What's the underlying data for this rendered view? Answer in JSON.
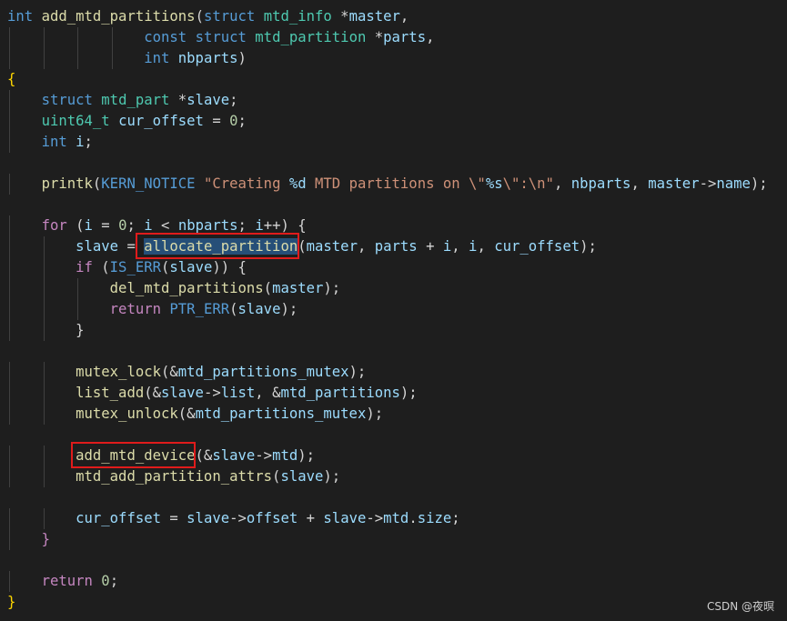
{
  "editor": {
    "language": "c",
    "theme_colors": {
      "background": "#1e1e1e",
      "keyword": "#569cd6",
      "type": "#4ec9b0",
      "function": "#dcdcaa",
      "variable": "#9cdcfe",
      "number": "#b5cea8",
      "string": "#ce9178",
      "macro": "#569cd6",
      "control": "#c586c0",
      "brace": "#ffd700",
      "default": "#d4d4d4",
      "highlight_border": "#e01b1b",
      "selection": "#264f78"
    },
    "lines": [
      [
        [
          "int",
          "keyword"
        ],
        [
          " ",
          "default"
        ],
        [
          "add_mtd_partitions",
          "function"
        ],
        [
          "(",
          "default"
        ],
        [
          "struct",
          "keyword"
        ],
        [
          " ",
          "default"
        ],
        [
          "mtd_info",
          "type"
        ],
        [
          " *",
          "default"
        ],
        [
          "master",
          "variable"
        ],
        [
          ",",
          "default"
        ]
      ],
      [
        [
          "                ",
          "default"
        ],
        [
          "const",
          "keyword"
        ],
        [
          " ",
          "default"
        ],
        [
          "struct",
          "keyword"
        ],
        [
          " ",
          "default"
        ],
        [
          "mtd_partition",
          "type"
        ],
        [
          " *",
          "default"
        ],
        [
          "parts",
          "variable"
        ],
        [
          ",",
          "default"
        ]
      ],
      [
        [
          "                ",
          "default"
        ],
        [
          "int",
          "keyword"
        ],
        [
          " ",
          "default"
        ],
        [
          "nbparts",
          "variable"
        ],
        [
          ")",
          "default"
        ]
      ],
      [
        [
          "{",
          "brace"
        ]
      ],
      [
        [
          "    ",
          "default"
        ],
        [
          "struct",
          "keyword"
        ],
        [
          " ",
          "default"
        ],
        [
          "mtd_part",
          "type"
        ],
        [
          " *",
          "default"
        ],
        [
          "slave",
          "variable"
        ],
        [
          ";",
          "default"
        ]
      ],
      [
        [
          "    ",
          "default"
        ],
        [
          "uint64_t",
          "type"
        ],
        [
          " ",
          "default"
        ],
        [
          "cur_offset",
          "variable"
        ],
        [
          " = ",
          "default"
        ],
        [
          "0",
          "number"
        ],
        [
          ";",
          "default"
        ]
      ],
      [
        [
          "    ",
          "default"
        ],
        [
          "int",
          "keyword"
        ],
        [
          " ",
          "default"
        ],
        [
          "i",
          "variable"
        ],
        [
          ";",
          "default"
        ]
      ],
      [],
      [
        [
          "    ",
          "default"
        ],
        [
          "printk",
          "function"
        ],
        [
          "(",
          "default"
        ],
        [
          "KERN_NOTICE",
          "macro"
        ],
        [
          " ",
          "default"
        ],
        [
          "\"Creating ",
          "string"
        ],
        [
          "%d",
          "variable"
        ],
        [
          " MTD partitions on ",
          "string"
        ],
        [
          "\\\"",
          "string"
        ],
        [
          "%s",
          "variable"
        ],
        [
          "\\\"",
          "string"
        ],
        [
          ":\\n\"",
          "string"
        ],
        [
          ", ",
          "default"
        ],
        [
          "nbparts",
          "variable"
        ],
        [
          ", ",
          "default"
        ],
        [
          "master",
          "variable"
        ],
        [
          "->",
          "default"
        ],
        [
          "name",
          "variable"
        ],
        [
          ");",
          "default"
        ]
      ],
      [],
      [
        [
          "    ",
          "default"
        ],
        [
          "for",
          "control"
        ],
        [
          " (",
          "default"
        ],
        [
          "i",
          "variable"
        ],
        [
          " = ",
          "default"
        ],
        [
          "0",
          "number"
        ],
        [
          "; ",
          "default"
        ],
        [
          "i",
          "variable"
        ],
        [
          " < ",
          "default"
        ],
        [
          "nbparts",
          "variable"
        ],
        [
          "; ",
          "default"
        ],
        [
          "i",
          "variable"
        ],
        [
          "++) {",
          "default"
        ]
      ],
      [
        [
          "        ",
          "default"
        ],
        [
          "slave",
          "variable"
        ],
        [
          " = ",
          "default"
        ],
        [
          "allocate_partition",
          "function"
        ],
        [
          "(",
          "default"
        ],
        [
          "master",
          "variable"
        ],
        [
          ", ",
          "default"
        ],
        [
          "parts",
          "variable"
        ],
        [
          " + ",
          "default"
        ],
        [
          "i",
          "variable"
        ],
        [
          ", ",
          "default"
        ],
        [
          "i",
          "variable"
        ],
        [
          ", ",
          "default"
        ],
        [
          "cur_offset",
          "variable"
        ],
        [
          ");",
          "default"
        ]
      ],
      [
        [
          "        ",
          "default"
        ],
        [
          "if",
          "control"
        ],
        [
          " (",
          "default"
        ],
        [
          "IS_ERR",
          "macro"
        ],
        [
          "(",
          "default"
        ],
        [
          "slave",
          "variable"
        ],
        [
          ")) {",
          "default"
        ]
      ],
      [
        [
          "            ",
          "default"
        ],
        [
          "del_mtd_partitions",
          "function"
        ],
        [
          "(",
          "default"
        ],
        [
          "master",
          "variable"
        ],
        [
          ");",
          "default"
        ]
      ],
      [
        [
          "            ",
          "default"
        ],
        [
          "return",
          "control"
        ],
        [
          " ",
          "default"
        ],
        [
          "PTR_ERR",
          "macro"
        ],
        [
          "(",
          "default"
        ],
        [
          "slave",
          "variable"
        ],
        [
          ");",
          "default"
        ]
      ],
      [
        [
          "        ",
          "default"
        ],
        [
          "}",
          "default"
        ]
      ],
      [],
      [
        [
          "        ",
          "default"
        ],
        [
          "mutex_lock",
          "function"
        ],
        [
          "(&",
          "default"
        ],
        [
          "mtd_partitions_mutex",
          "variable"
        ],
        [
          ");",
          "default"
        ]
      ],
      [
        [
          "        ",
          "default"
        ],
        [
          "list_add",
          "function"
        ],
        [
          "(&",
          "default"
        ],
        [
          "slave",
          "variable"
        ],
        [
          "->",
          "default"
        ],
        [
          "list",
          "variable"
        ],
        [
          ", &",
          "default"
        ],
        [
          "mtd_partitions",
          "variable"
        ],
        [
          ");",
          "default"
        ]
      ],
      [
        [
          "        ",
          "default"
        ],
        [
          "mutex_unlock",
          "function"
        ],
        [
          "(&",
          "default"
        ],
        [
          "mtd_partitions_mutex",
          "variable"
        ],
        [
          ");",
          "default"
        ]
      ],
      [],
      [
        [
          "        ",
          "default"
        ],
        [
          "add_mtd_device",
          "function"
        ],
        [
          "(&",
          "default"
        ],
        [
          "slave",
          "variable"
        ],
        [
          "->",
          "default"
        ],
        [
          "mtd",
          "variable"
        ],
        [
          ");",
          "default"
        ]
      ],
      [
        [
          "        ",
          "default"
        ],
        [
          "mtd_add_partition_attrs",
          "function"
        ],
        [
          "(",
          "default"
        ],
        [
          "slave",
          "variable"
        ],
        [
          ");",
          "default"
        ]
      ],
      [],
      [
        [
          "        ",
          "default"
        ],
        [
          "cur_offset",
          "variable"
        ],
        [
          " = ",
          "default"
        ],
        [
          "slave",
          "variable"
        ],
        [
          "->",
          "default"
        ],
        [
          "offset",
          "variable"
        ],
        [
          " + ",
          "default"
        ],
        [
          "slave",
          "variable"
        ],
        [
          "->",
          "default"
        ],
        [
          "mtd",
          "variable"
        ],
        [
          ".",
          "default"
        ],
        [
          "size",
          "variable"
        ],
        [
          ";",
          "default"
        ]
      ],
      [
        [
          "    ",
          "default"
        ],
        [
          "}",
          "control"
        ]
      ],
      [],
      [
        [
          "    ",
          "default"
        ],
        [
          "return",
          "control"
        ],
        [
          " ",
          "default"
        ],
        [
          "0",
          "number"
        ],
        [
          ";",
          "default"
        ]
      ],
      [
        [
          "}",
          "brace"
        ]
      ]
    ]
  },
  "watermark": "CSDN @夜暝"
}
